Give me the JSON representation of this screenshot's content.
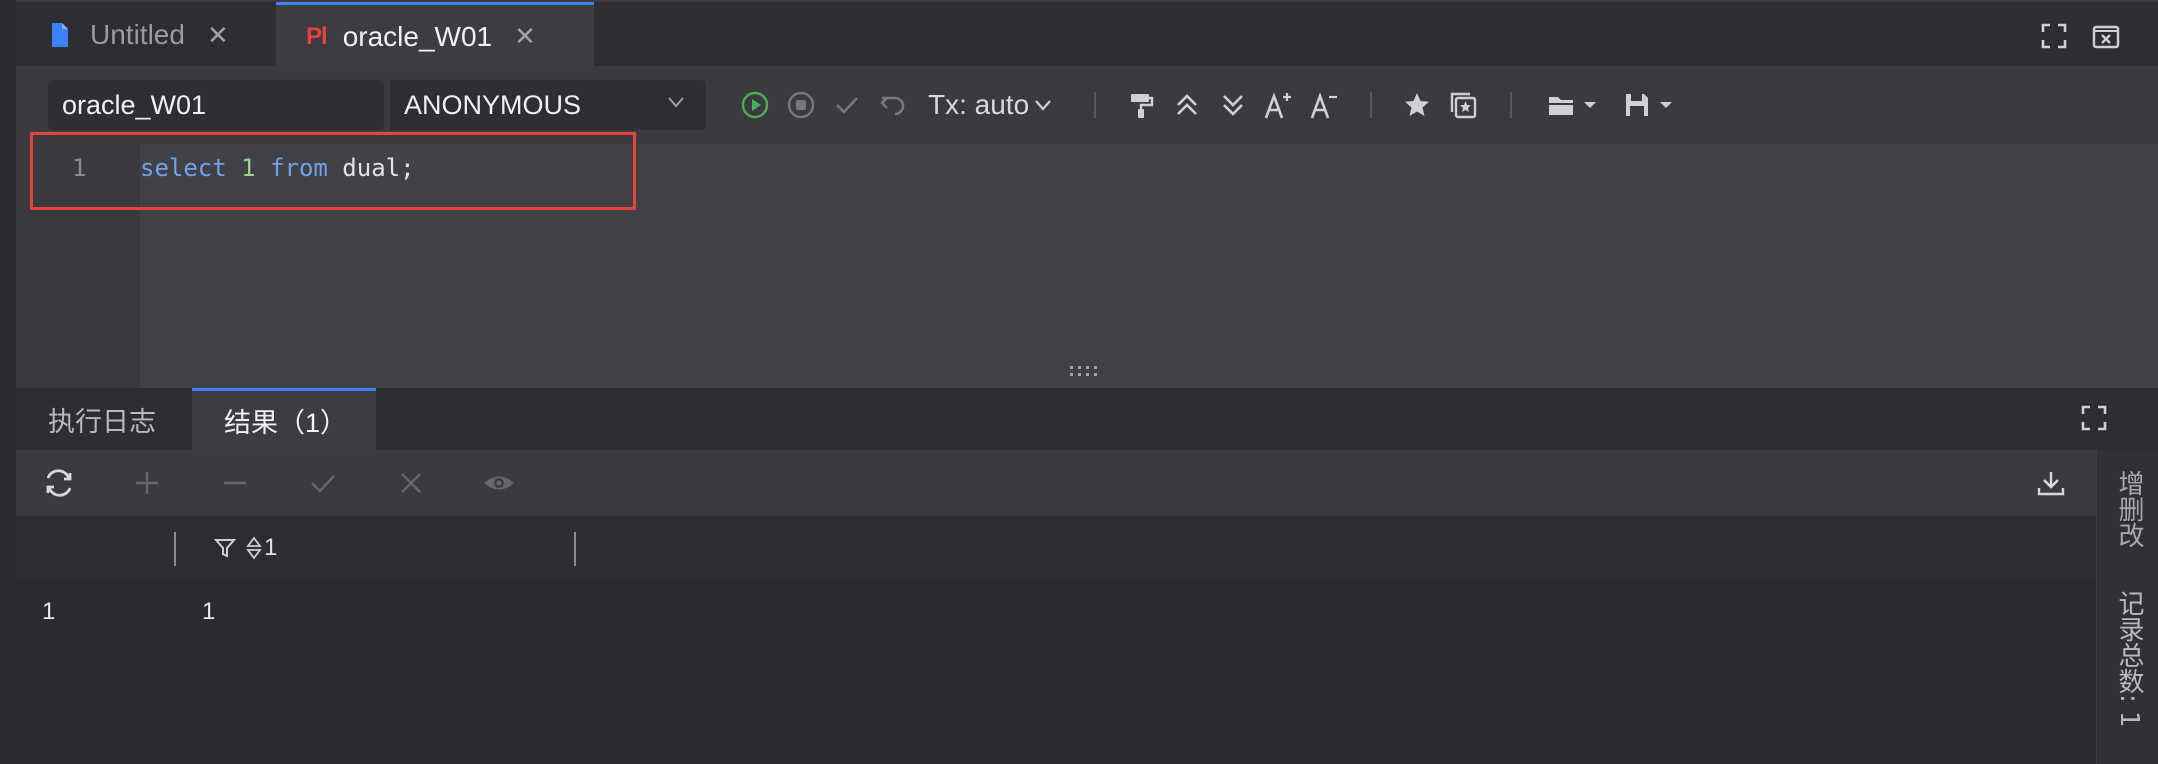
{
  "tabs": [
    {
      "label": "Untitled",
      "icon": "document-icon",
      "active": false
    },
    {
      "label": "oracle_W01",
      "badge": "Pl",
      "icon": "pl-badge",
      "active": true
    }
  ],
  "toolbar": {
    "connection": "oracle_W01",
    "schema": "ANONYMOUS",
    "tx_mode": "Tx: auto"
  },
  "editor": {
    "lines": [
      {
        "number": "1",
        "tokens": [
          {
            "text": "select",
            "type": "kw"
          },
          {
            "text": " ",
            "type": "id"
          },
          {
            "text": "1",
            "type": "num"
          },
          {
            "text": " ",
            "type": "id"
          },
          {
            "text": "from",
            "type": "kw"
          },
          {
            "text": " dual;",
            "type": "id"
          }
        ]
      }
    ],
    "highlight_color": "#e5443a"
  },
  "result_tabs": [
    {
      "label": "执行日志",
      "active": false
    },
    {
      "label": "结果（1）",
      "active": true
    }
  ],
  "grid": {
    "columns": [
      {
        "label": "1"
      }
    ],
    "rows": [
      {
        "row_number": "1",
        "values": [
          "1"
        ]
      }
    ]
  },
  "side_panel": {
    "edit_label": "增删改",
    "record_count_label": "记录总数: 1"
  },
  "colors": {
    "accent": "#3c82f6",
    "run": "#4caf50",
    "highlight": "#e5443a"
  }
}
